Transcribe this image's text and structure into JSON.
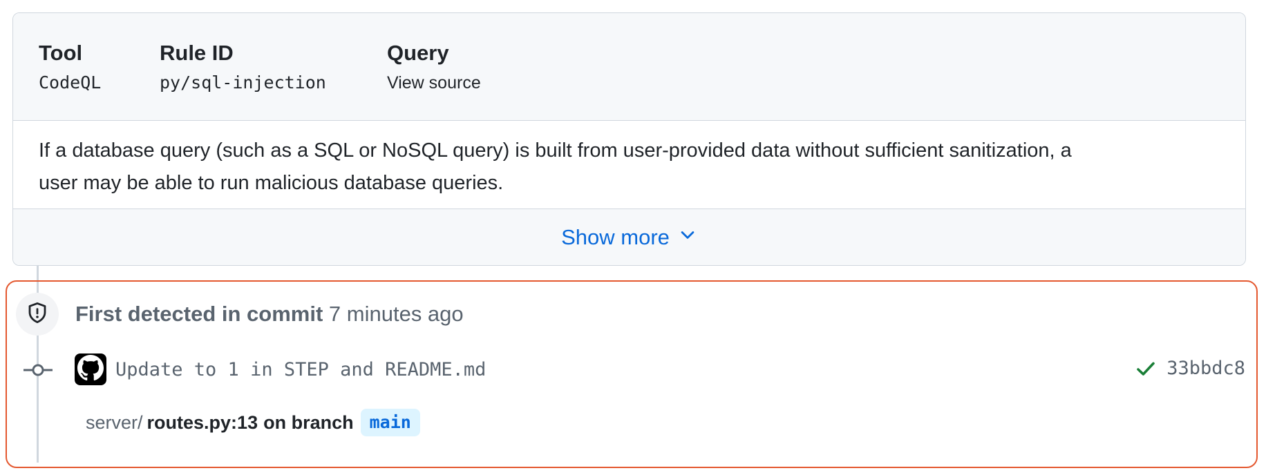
{
  "rule_card": {
    "tool_label": "Tool",
    "tool_value": "CodeQL",
    "rule_id_label": "Rule ID",
    "rule_id_value": "py/sql-injection",
    "query_label": "Query",
    "query_value": "View source",
    "description_line1": "If a database query (such as a SQL or NoSQL query) is built from user-provided data without sufficient sanitization, a",
    "description_line2": "user may be able to run malicious database queries.",
    "show_more_label": "Show more"
  },
  "detection": {
    "title": "First detected in commit",
    "time_ago": "7 minutes ago",
    "commit_message": "Update to 1 in STEP and README.md",
    "commit_sha": "33bbdc8",
    "path_dir": "server/",
    "path_file": "routes.py:13",
    "on_branch_text": "on branch",
    "branch": "main"
  },
  "colors": {
    "link": "#0969da",
    "highlight_border": "#e4572e",
    "check_green": "#1a7f37",
    "branch_chip_bg": "#ddf4ff",
    "muted_text": "#59636e",
    "border": "#d0d7de"
  },
  "icons": {
    "show_more": "chevron-down-icon",
    "alert": "shield-alert-icon",
    "commit_node": "git-commit-icon",
    "avatar": "github-mark-icon",
    "status": "check-icon"
  }
}
